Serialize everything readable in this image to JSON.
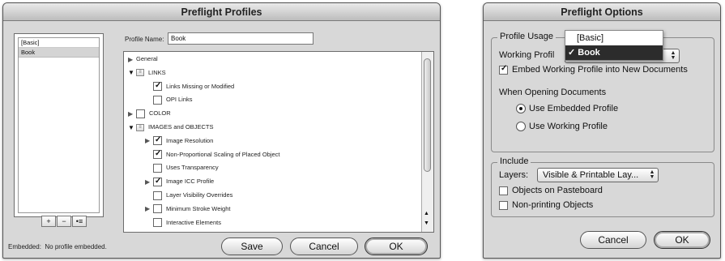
{
  "profiles_dialog": {
    "title": "Preflight Profiles",
    "profile_list": [
      "[Basic]",
      "Book"
    ],
    "selected_profile": "Book",
    "list_buttons": [
      "+",
      "−",
      "•≡"
    ],
    "profile_name_label": "Profile Name:",
    "profile_name_value": "Book",
    "tree": [
      {
        "label": "General",
        "level": 0,
        "expander": "closed",
        "check": "none",
        "flag": false
      },
      {
        "label": "LINKS",
        "level": 0,
        "expander": "open",
        "check": "flag",
        "flag": true
      },
      {
        "label": "Links Missing or Modified",
        "level": 1,
        "expander": "none",
        "check": "on",
        "flag": false
      },
      {
        "label": "OPI Links",
        "level": 1,
        "expander": "none",
        "check": "off",
        "flag": false
      },
      {
        "label": "COLOR",
        "level": 0,
        "expander": "closed",
        "check": "off",
        "flag": false
      },
      {
        "label": "IMAGES and OBJECTS",
        "level": 0,
        "expander": "open",
        "check": "flag",
        "flag": true
      },
      {
        "label": "Image Resolution",
        "level": 1,
        "expander": "closed",
        "check": "on",
        "flag": false
      },
      {
        "label": "Non-Proportional Scaling of Placed Object",
        "level": 1,
        "expander": "none",
        "check": "on",
        "flag": false
      },
      {
        "label": "Uses Transparency",
        "level": 1,
        "expander": "none",
        "check": "off",
        "flag": false
      },
      {
        "label": "Image ICC Profile",
        "level": 1,
        "expander": "closed",
        "check": "on",
        "flag": false
      },
      {
        "label": "Layer Visibility Overrides",
        "level": 1,
        "expander": "none",
        "check": "off",
        "flag": false
      },
      {
        "label": "Minimum Stroke Weight",
        "level": 1,
        "expander": "closed",
        "check": "off",
        "flag": false
      },
      {
        "label": "Interactive Elements",
        "level": 1,
        "expander": "none",
        "check": "off",
        "flag": false
      }
    ],
    "status_text": "Embedded:  No profile embedded.",
    "buttons": {
      "save": "Save",
      "cancel": "Cancel",
      "ok": "OK"
    }
  },
  "options_dialog": {
    "title": "Preflight Options",
    "profile_usage_title": "Profile Usage",
    "working_profile_label": "Working Profil",
    "working_profile_menu": [
      {
        "label": "[Basic]",
        "checked": false
      },
      {
        "label": "Book",
        "checked": true,
        "mark": "✓"
      }
    ],
    "embed_checkbox_label": "Embed Working Profile into New Documents",
    "embed_checked": true,
    "when_opening_label": "When Opening Documents",
    "radio_embedded": "Use Embedded Profile",
    "radio_working": "Use Working Profile",
    "radio_selected": "embedded",
    "include_title": "Include",
    "layers_label": "Layers:",
    "layers_value": "Visible & Printable Lay...",
    "objects_pasteboard": "Objects on Pasteboard",
    "nonprinting_objects": "Non-printing Objects",
    "buttons": {
      "cancel": "Cancel",
      "ok": "OK"
    }
  }
}
